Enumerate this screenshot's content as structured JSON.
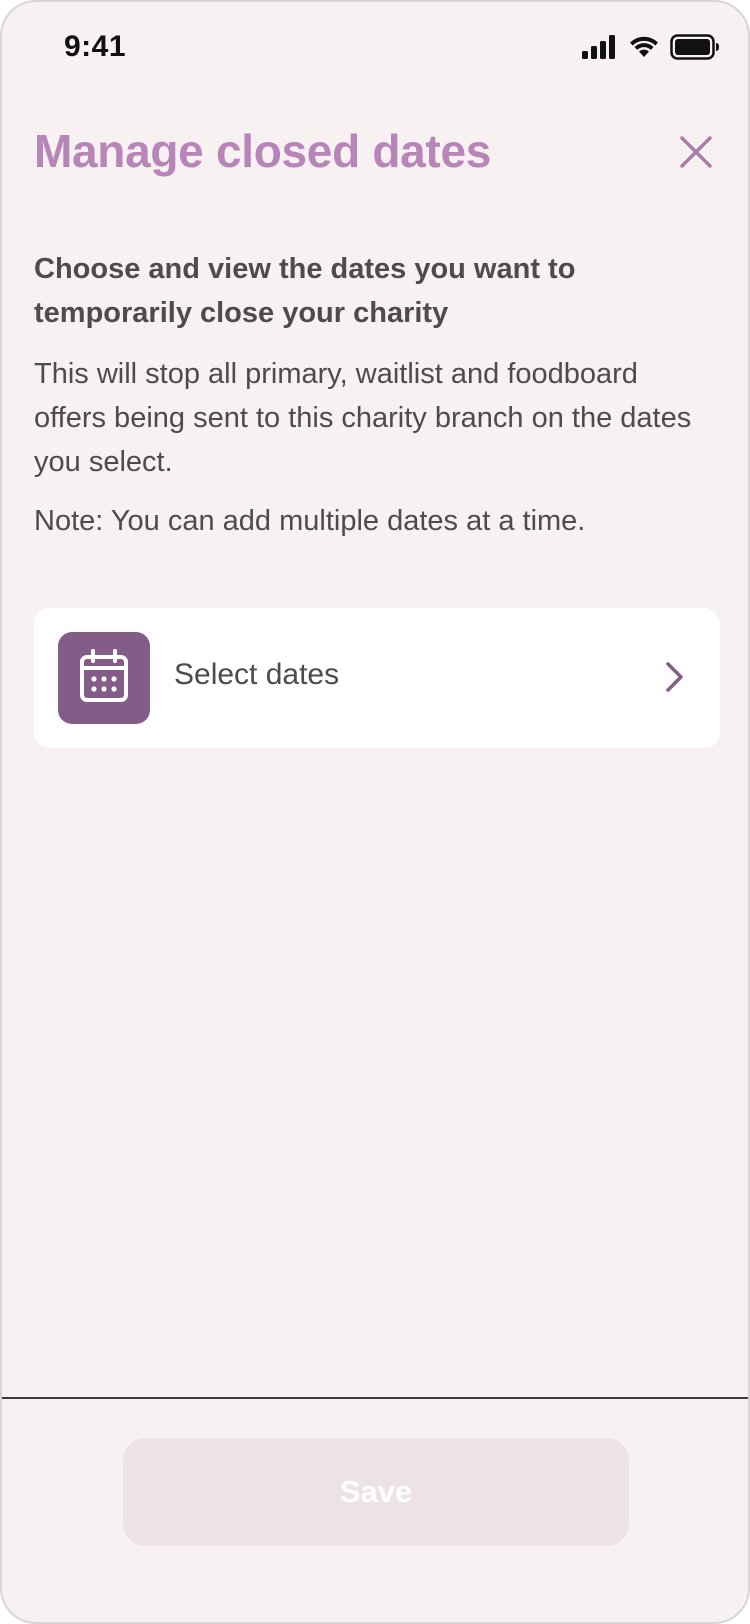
{
  "status_bar": {
    "time": "9:41",
    "icons": [
      "cellular-signal-icon",
      "wifi-icon",
      "battery-icon"
    ]
  },
  "header": {
    "title": "Manage closed dates",
    "close_icon": "close-icon"
  },
  "content": {
    "subheading": "Choose and view the dates you want to temporarily close your charity",
    "description": "This will stop all primary, waitlist and foodboard offers being sent to this charity branch on the dates you select.",
    "note": "Note: You can add multiple dates at a time."
  },
  "select_dates": {
    "label": "Select dates",
    "icon": "calendar-icon",
    "chevron_icon": "chevron-right-icon"
  },
  "footer": {
    "save_label": "Save",
    "save_disabled": true
  },
  "colors": {
    "background": "#f7f1f2",
    "title": "#b785b8",
    "accent": "#845c88",
    "text": "#4d4b4b",
    "card": "#ffffff",
    "save_button_disabled": "#ede3e7"
  }
}
